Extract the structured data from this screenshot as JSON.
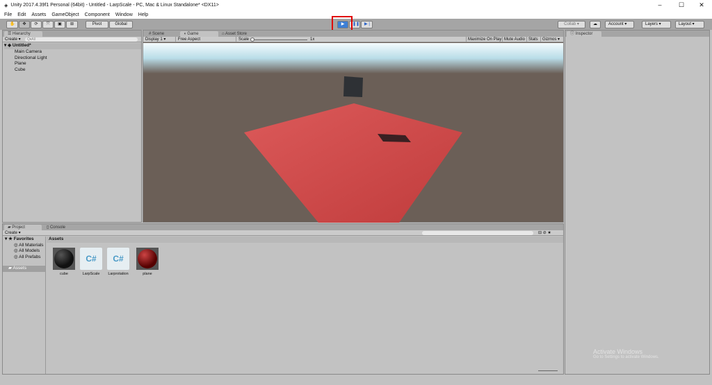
{
  "window": {
    "title": "Unity 2017.4.39f1 Personal (64bit) - Untitled - LarpScale - PC, Mac & Linux Standalone* <DX11>"
  },
  "menu": [
    "File",
    "Edit",
    "Assets",
    "GameObject",
    "Component",
    "Window",
    "Help"
  ],
  "toolbar": {
    "pivot": "Pivot",
    "global": "Global",
    "collab": "Collab",
    "account": "Account",
    "layers": "Layers",
    "layout": "Layout"
  },
  "hierarchy": {
    "tab": "Hierarchy",
    "create": "Create",
    "search_placeholder": "Q▾All",
    "scene": "Untitled*",
    "items": [
      "Main Camera",
      "Directional Light",
      "Plane",
      "Cube"
    ]
  },
  "center": {
    "tabs": [
      "Scene",
      "Game",
      "Asset Store"
    ],
    "display": "Display 1",
    "aspect": "Free Aspect",
    "scale_label": "Scale",
    "scale_value": "1x",
    "maximize": "Maximize On Play",
    "mute": "Mute Audio",
    "stats": "Stats",
    "gizmos": "Gizmos"
  },
  "inspector": {
    "tab": "Inspector"
  },
  "project": {
    "tabs": [
      "Project",
      "Console"
    ],
    "create": "Create",
    "favorites": "Favorites",
    "fav_items": [
      "All Materials",
      "All Models",
      "All Prefabs"
    ],
    "assets_root": "Assets",
    "breadcrumb": "Assets",
    "assets": [
      {
        "name": "cube",
        "type": "material",
        "color": "#111111"
      },
      {
        "name": "LarpScale",
        "type": "script"
      },
      {
        "name": "Larprotation",
        "type": "script"
      },
      {
        "name": "plane",
        "type": "material",
        "color": "#7a1414"
      }
    ]
  },
  "watermark": {
    "line1": "Activate Windows",
    "line2": "Go to Settings to activate Windows."
  },
  "colors": {
    "highlight": "#e00000",
    "plane": "#d44a4a",
    "ground": "#6b5f57"
  }
}
